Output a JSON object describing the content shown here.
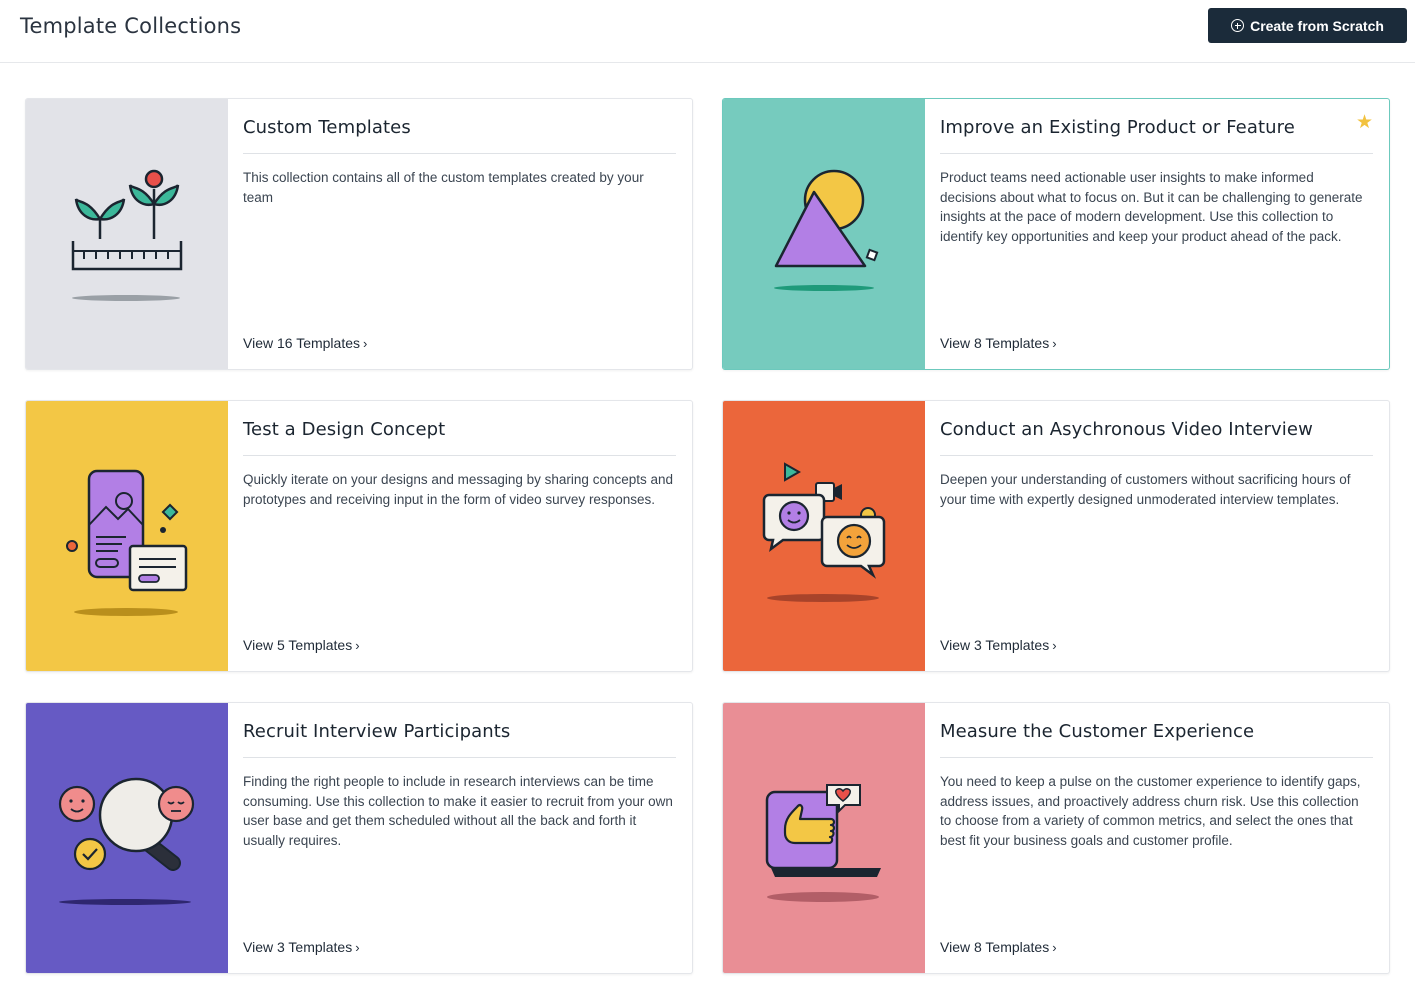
{
  "header": {
    "title": "Template Collections",
    "create_label": "Create from Scratch"
  },
  "collections": [
    {
      "title": "Custom Templates",
      "description": "This collection contains all of the custom templates created by your team",
      "link": "View 16 Templates",
      "art_color": "#e2e3e8",
      "starred": false
    },
    {
      "title": "Improve an Existing Product or Feature",
      "description": "Product teams need actionable user insights to make informed decisions about what to focus on. But it can be challenging to generate insights at the pace of modern development. Use this collection to identify key opportunities and keep your product ahead of the pack.",
      "link": "View 8 Templates",
      "art_color": "#76cbbe",
      "starred": true
    },
    {
      "title": "Test a Design Concept",
      "description": "Quickly iterate on your designs and messaging by sharing concepts and prototypes and receiving input in the form of video survey responses.",
      "link": "View 5 Templates",
      "art_color": "#f3c745",
      "starred": false
    },
    {
      "title": "Conduct an Asychronous Video Interview",
      "description": "Deepen your understanding of customers without sacrificing hours of your time with expertly designed unmoderated interview templates.",
      "link": "View 3 Templates",
      "art_color": "#eb663b",
      "starred": false
    },
    {
      "title": "Recruit Interview Participants",
      "description": "Finding the right people to include in research interviews can be time consuming. Use this collection to make it easier to recruit from your own user base and get them scheduled without all the back and forth it usually requires.",
      "link": "View 3 Templates",
      "art_color": "#665ac4",
      "starred": false
    },
    {
      "title": "Measure the Customer Experience",
      "description": "You need to keep a pulse on the customer experience to identify gaps, address issues, and proactively address churn risk. Use this collection to choose from a variety of common metrics, and select the ones that best fit your business goals and customer profile.",
      "link": "View 8 Templates",
      "art_color": "#e98e95",
      "starred": false
    }
  ]
}
